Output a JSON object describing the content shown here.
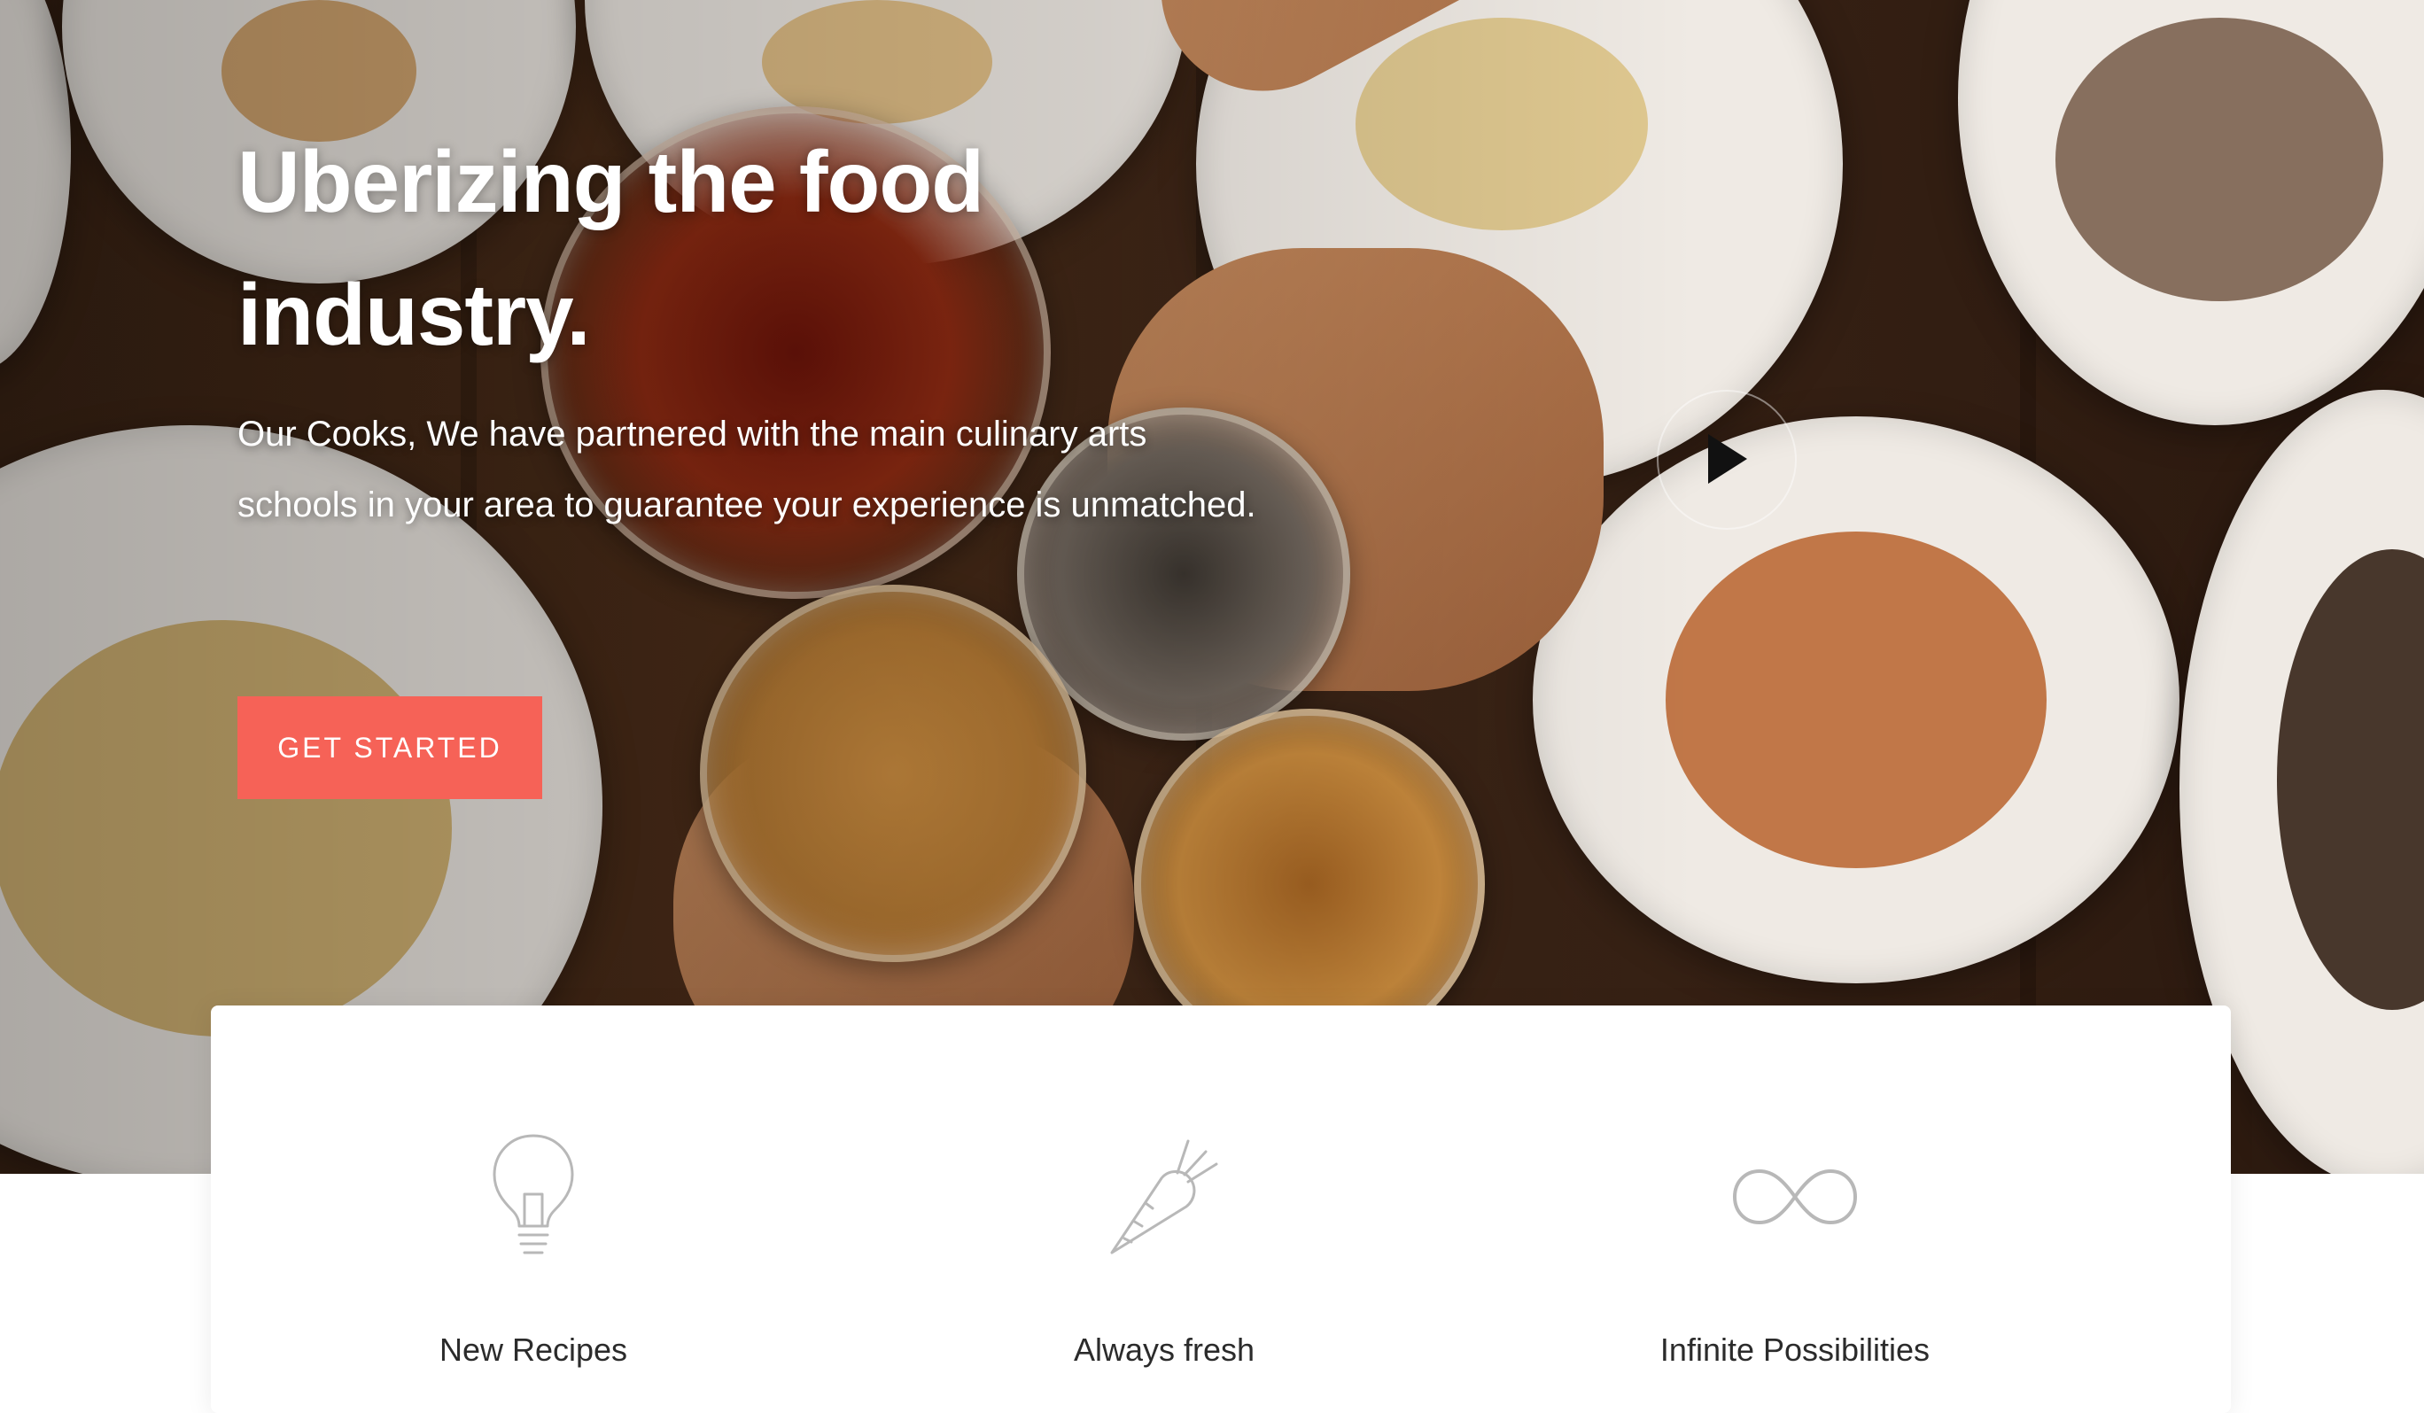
{
  "hero": {
    "title": "Uberizing the food industry.",
    "subtitle": "Our Cooks, We have partnered with the main culinary arts schools in your area to guarantee your experience is unmatched.",
    "cta_label": "GET STARTED"
  },
  "features": [
    {
      "label": "New Recipes",
      "icon": "lightbulb-icon"
    },
    {
      "label": "Always fresh",
      "icon": "carrot-icon"
    },
    {
      "label": "Infinite Possibilities",
      "icon": "infinity-icon"
    }
  ],
  "colors": {
    "accent": "#f66257",
    "card_background": "#ffffff",
    "text_dark": "#2b2b2b",
    "icon_gray": "#b8b8b8"
  }
}
